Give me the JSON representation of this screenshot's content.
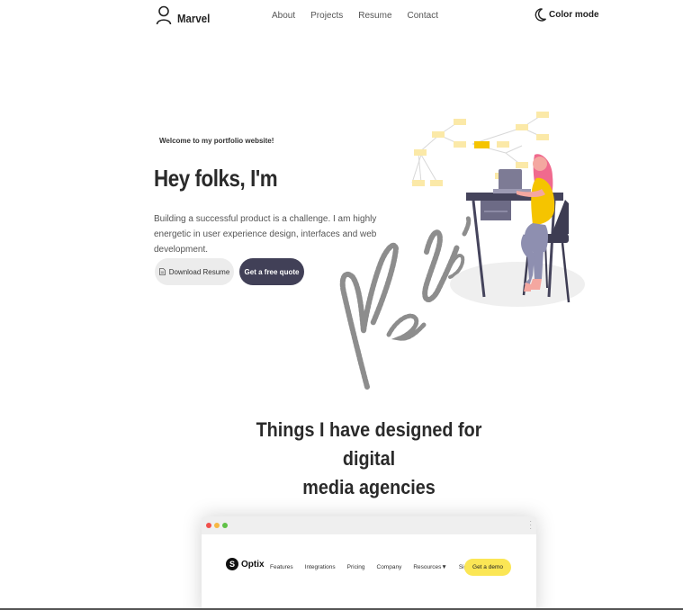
{
  "header": {
    "brand": "Marvel",
    "nav": [
      "About",
      "Projects",
      "Resume",
      "Contact"
    ],
    "color_mode_label": "Color mode"
  },
  "hero": {
    "eyebrow": "Welcome to my portfolio website!",
    "title": "Hey folks, I'm",
    "description": "Building a successful product is a challenge. I am highly energetic in user experience design, interfaces and web development.",
    "download_label": "Download Resume",
    "quote_label": "Get a free quote"
  },
  "section": {
    "title_line1": "Things I have designed for digital",
    "title_line2": "media agencies"
  },
  "browser_mock": {
    "logo": "Optix",
    "logo_mark": "S",
    "nav": [
      "Features",
      "Integrations",
      "Pricing",
      "Company",
      "Resources▼",
      "Sign in"
    ],
    "cta": "Get a demo"
  },
  "colors": {
    "accent_dark": "#414057",
    "cta_yellow": "#fbe655",
    "mindmap_yellow": "#fbe9a8",
    "mindmap_highlight": "#f5c400"
  }
}
